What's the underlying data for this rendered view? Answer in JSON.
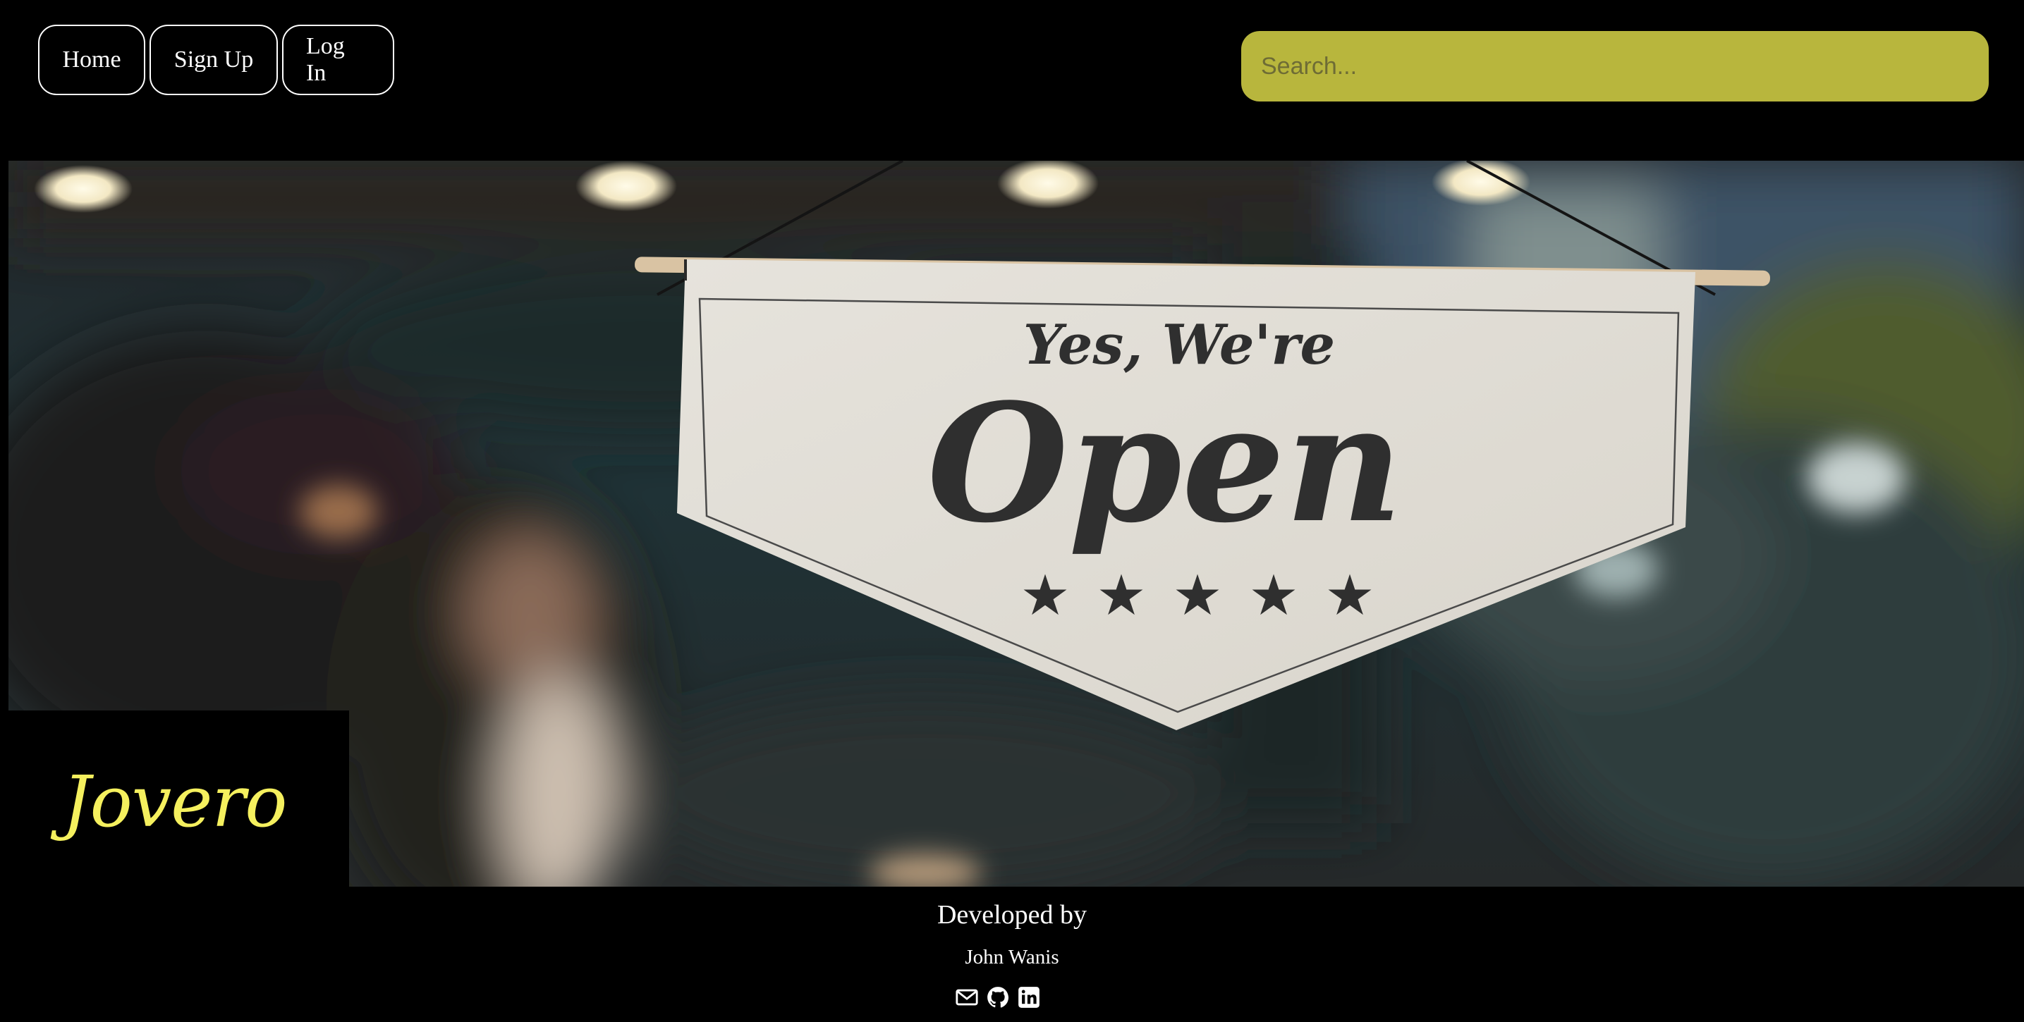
{
  "nav": {
    "home_label": "Home",
    "signup_label": "Sign Up",
    "login_label": "Log In"
  },
  "search": {
    "placeholder": "Search..."
  },
  "hero": {
    "image": "storefront photo with hanging canvas banner",
    "banner_top_text": "Yes, We're",
    "banner_main_text": "Open",
    "banner_stars": 5
  },
  "brand": {
    "name": "Jovero",
    "color": "#f5f05e"
  },
  "footer": {
    "developed_by": "Developed by",
    "developer": "John Wanis",
    "icons": [
      "envelope-icon",
      "github-icon",
      "linkedin-icon"
    ]
  },
  "colors": {
    "background": "#000000",
    "search_bg": "#b8b63d",
    "accent_text": "#f5f05e"
  }
}
